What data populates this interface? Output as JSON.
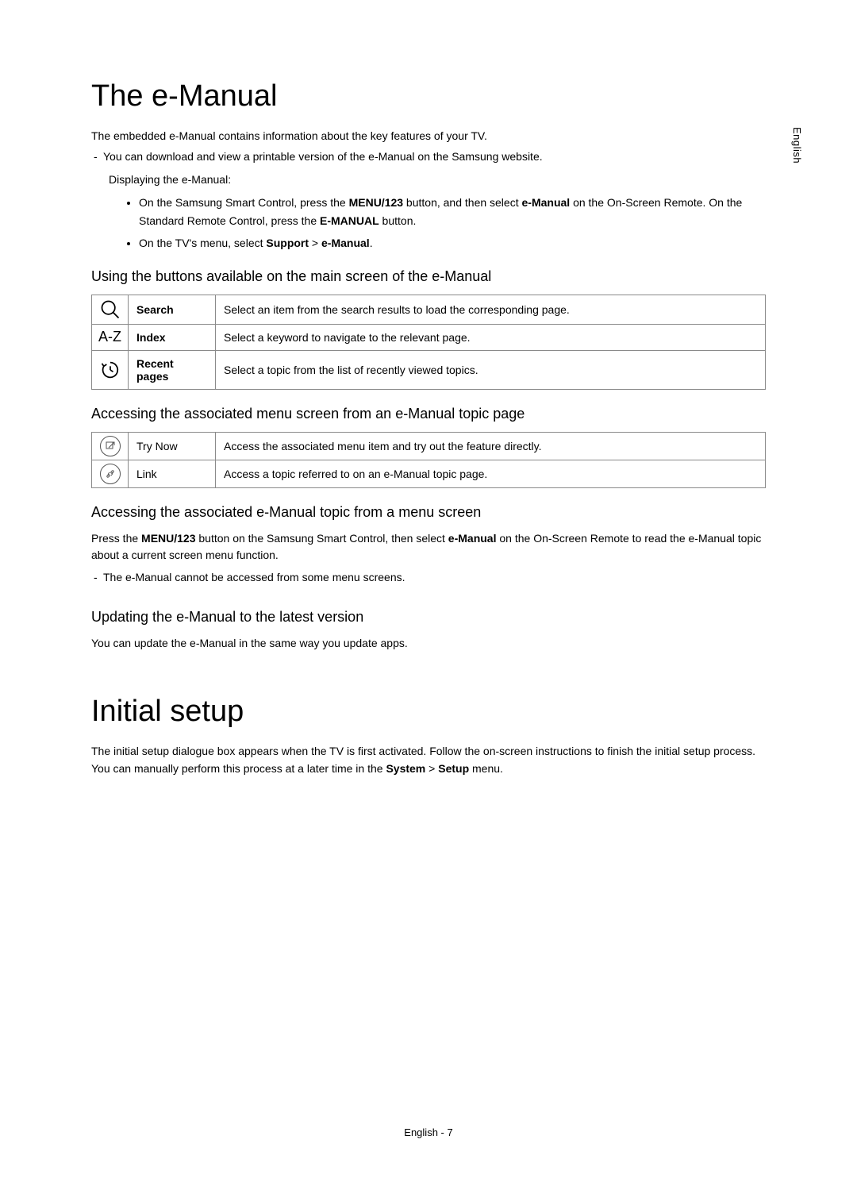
{
  "side_label": "English",
  "h1_emanual": "The e-Manual",
  "intro": "The embedded e-Manual contains information about the key features of your TV.",
  "download_note": "You can download and view a printable version of the e-Manual on the Samsung website.",
  "displaying_label": "Displaying the e-Manual:",
  "bullet1": {
    "p1": "On the Samsung Smart Control, press the ",
    "b1": "MENU/123",
    "p2": " button, and then select ",
    "b2": "e-Manual",
    "p3": " on the On-Screen Remote. On the Standard Remote Control, press the ",
    "b3": "E-MANUAL",
    "p4": " button."
  },
  "bullet2": {
    "p1": "On the TV's menu, select ",
    "b1": "Support",
    "p2": " > ",
    "b2": "e-Manual",
    "p3": "."
  },
  "h2_using": "Using the buttons available on the main screen of the e-Manual",
  "table1": [
    {
      "icon": "search",
      "label": "Search",
      "desc": "Select an item from the search results to load the corresponding page."
    },
    {
      "icon": "az",
      "label": "Index",
      "desc": "Select a keyword to navigate to the relevant page."
    },
    {
      "icon": "recent",
      "label": "Recent pages",
      "desc": "Select a topic from the list of recently viewed topics."
    }
  ],
  "h2_access_menu": "Accessing the associated menu screen from an e-Manual topic page",
  "table2": [
    {
      "icon": "trynow",
      "label": "Try Now",
      "desc": "Access the associated menu item and try out the feature directly."
    },
    {
      "icon": "link",
      "label": "Link",
      "desc": "Access a topic referred to on an e-Manual topic page."
    }
  ],
  "h2_access_topic": "Accessing the associated e-Manual topic from a menu screen",
  "access_topic_para": {
    "p1": "Press the ",
    "b1": "MENU/123",
    "p2": " button on the Samsung Smart Control, then select ",
    "b2": "e-Manual",
    "p3": " on the On-Screen Remote to read the e-Manual topic about a current screen menu function."
  },
  "access_topic_note": "The e-Manual cannot be accessed from some menu screens.",
  "h2_updating": "Updating the e-Manual to the latest version",
  "updating_text": "You can update the e-Manual in the same way you update apps.",
  "h1_initial": "Initial setup",
  "initial_para": {
    "p1": "The initial setup dialogue box appears when the TV is first activated. Follow the on-screen instructions to finish the initial setup process. You can manually perform this process at a later time in the ",
    "b1": "System",
    "p2": " > ",
    "b2": "Setup",
    "p3": " menu."
  },
  "footer": "English - 7",
  "icon_az_text": "A-Z"
}
